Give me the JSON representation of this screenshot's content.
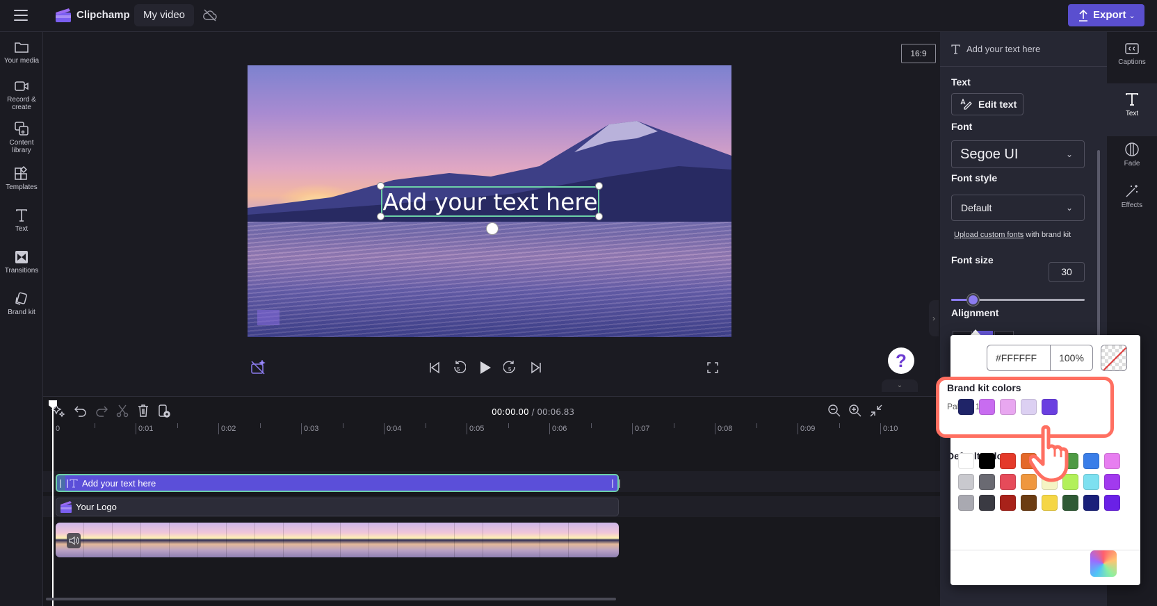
{
  "app": {
    "name": "Clipchamp",
    "project_name": "My video",
    "export_label": "Export",
    "sync_status_icon": "cloud-off-icon"
  },
  "left_sidebar": {
    "items": [
      {
        "label": "Your media",
        "icon": "folder-icon"
      },
      {
        "label": "Record & create",
        "icon": "camera-icon"
      },
      {
        "label": "Content library",
        "icon": "content-library-icon"
      },
      {
        "label": "Templates",
        "icon": "templates-icon"
      },
      {
        "label": "Text",
        "icon": "text-icon"
      },
      {
        "label": "Transitions",
        "icon": "transitions-icon"
      },
      {
        "label": "Brand kit",
        "icon": "brand-kit-icon"
      }
    ]
  },
  "preview": {
    "aspect_ratio": "16:9",
    "overlay_text": "Add your text here",
    "help_label": "?"
  },
  "timeline": {
    "current_time": "00:00.00",
    "total_time": "/ 00:06.83",
    "ruler_labels": [
      "0",
      "0:01",
      "0:02",
      "0:03",
      "0:04",
      "0:05",
      "0:06",
      "0:07",
      "0:08",
      "0:09",
      "0:10"
    ],
    "tracks": [
      {
        "type": "text",
        "label": "Add your text here"
      },
      {
        "type": "logo",
        "label": "Your Logo"
      },
      {
        "type": "video",
        "label": ""
      }
    ]
  },
  "properties": {
    "header": "Add your text here",
    "text_section": "Text",
    "edit_text_label": "Edit text",
    "font_section": "Font",
    "font_value": "Segoe UI",
    "font_style_section": "Font style",
    "font_style_value": "Default",
    "upload_link": "Upload custom fonts",
    "upload_suffix": " with brand kit",
    "font_size_section": "Font size",
    "font_size_value": "30",
    "font_size_slider_fraction": 0.16,
    "alignment_section": "Alignment"
  },
  "right_rail": {
    "items": [
      {
        "label": "Captions",
        "icon": "captions-icon"
      },
      {
        "label": "Text",
        "icon": "text-icon",
        "active": true
      },
      {
        "label": "Fade",
        "icon": "fade-icon"
      },
      {
        "label": "Effects",
        "icon": "effects-icon"
      }
    ]
  },
  "color_picker": {
    "hex_value": "#FFFFFF",
    "opacity_value": "100%",
    "brand_kit_title": "Brand kit colors",
    "palette_label": "Palette 1",
    "brand_colors": [
      "#1f2468",
      "#c86cf0",
      "#e8a7f0",
      "#dcd0f2",
      "#6a3fe0"
    ],
    "default_title": "Default colors",
    "default_colors": [
      [
        "#ffffff",
        "#000000",
        "#e43a2a",
        "#e4692a",
        "#eef04a",
        "#4e9a44",
        "#3a7ee8",
        "#e77ef0"
      ],
      [
        "#c9c9ce",
        "#6a6a72",
        "#e64b5a",
        "#ef973f",
        "#f5f4c4",
        "#b2f05a",
        "#7de0f0",
        "#a23aee"
      ],
      [
        "#a9a9b1",
        "#3a3a42",
        "#a8221a",
        "#6b3c12",
        "#f5d645",
        "#2f5a35",
        "#1a207a",
        "#6a21e6"
      ]
    ]
  }
}
